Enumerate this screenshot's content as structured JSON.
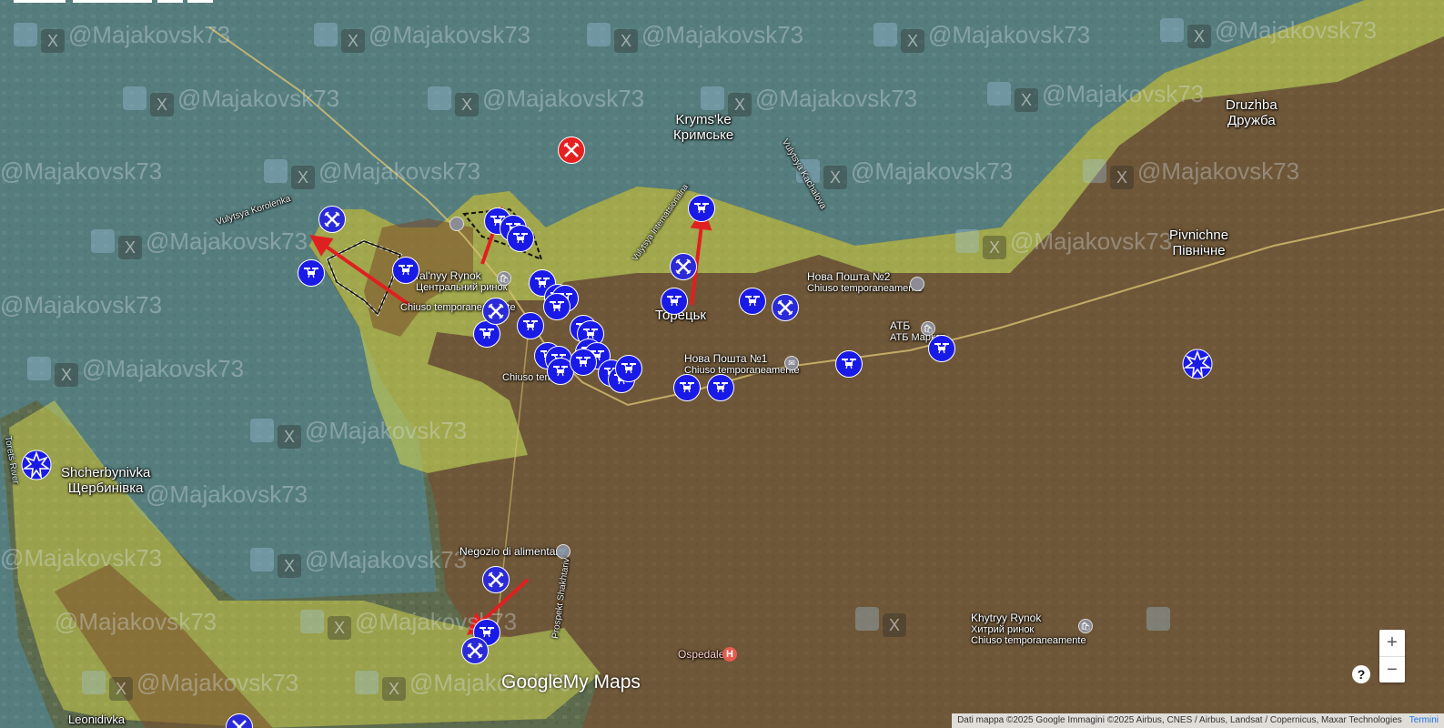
{
  "watermark": {
    "handle": "@Majakovsk73",
    "x_glyph": "X"
  },
  "places": {
    "krymske_lat": "Kryms'ke",
    "krymske_cyr": "Кримське",
    "druzhba_lat": "Druzhba",
    "druzhba_cyr": "Дружба",
    "pivnichne_lat": "Pivnichne",
    "pivnichne_cyr": "Північне",
    "shcherbynivka_lat": "Shcherbynivka",
    "shcherbynivka_cyr": "Щербинівка",
    "toretsk_lat": "k",
    "toretsk_cyr": "Торецьк",
    "leonidivka": "Leonidivka"
  },
  "pois": {
    "market_lat": "ral'nyy Rynok",
    "market_cyr": "Центральний ринок",
    "market_status": "Chiuso temporaneamente",
    "novaposhta2": "Нова Пошта №2",
    "novaposhta2_status": "Chiuso temporaneamente",
    "atb": "АТБ",
    "atb_sub": "АТБ Маркет",
    "novaposhta1": "Нова Пошта №1",
    "novaposhta1_status": "Chiuso temporaneamente",
    "shop_status": "Chiuso tempo",
    "grocery": "Negozio di alimentari",
    "khytryy_lat": "Khytryy Rynok",
    "khytryy_cyr": "Хитрий ринок",
    "khytryy_status": "Chiuso temporaneamente",
    "hospital": "Ospedale"
  },
  "streets": {
    "korolenka": "Vulytsya Korolenka",
    "kachalova": "Vulytsya Kachalova",
    "street_north": "Vulytsya Internatsionalna",
    "shakhtariv": "Prospekt Shakhtariv",
    "river": "Toretś River"
  },
  "branding": {
    "google": "Google",
    "mymaps": "My Maps"
  },
  "attribution": {
    "text": "Dati mappa ©2025 Google Immagini ©2025 Airbus, CNES / Airbus, Landsat / Copernicus, Maxar Technologies",
    "terms": "Termini"
  },
  "controls": {
    "zoom_in": "+",
    "zoom_out": "−",
    "help": "?"
  },
  "colors": {
    "russian_control": "#7a4a2a",
    "contested": "#d8d84a",
    "ukrainian_control": "#4aa0d8",
    "drone_marker": "#1a1ae6",
    "attack_arrow": "#e02020"
  },
  "icons": {
    "drone": "drone-icon",
    "crossed_swords": "crossed-swords-icon",
    "explosion": "explosion-icon",
    "attack_arrow": "red-arrow"
  }
}
